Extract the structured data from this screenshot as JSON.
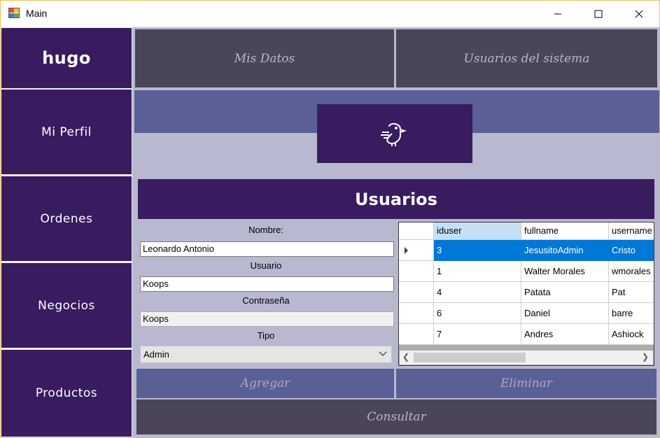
{
  "window": {
    "title": "Main"
  },
  "sidebar": {
    "brand": "hugo",
    "items": [
      {
        "label": "Mi Perfil"
      },
      {
        "label": "Ordenes"
      },
      {
        "label": "Negocios"
      },
      {
        "label": "Productos"
      }
    ]
  },
  "topnav": {
    "tabs": [
      {
        "label": "Mis Datos"
      },
      {
        "label": "Usuarios del sistema"
      }
    ]
  },
  "section": {
    "title": "Usuarios"
  },
  "form": {
    "nombre_label": "Nombre:",
    "nombre_value": "Leonardo Antonio",
    "usuario_label": "Usuario",
    "usuario_value": "Koops",
    "password_label": "Contraseña",
    "password_value": "Koops",
    "tipo_label": "Tipo",
    "tipo_value": "Admin"
  },
  "table": {
    "columns": [
      "iduser",
      "fullname",
      "username"
    ],
    "rows": [
      [
        "3",
        "JesusitoAdmin",
        "Cristo"
      ],
      [
        "1",
        "Walter Morales",
        "wmorales"
      ],
      [
        "4",
        "Patata",
        "Pat"
      ],
      [
        "6",
        "Daniel",
        "barre"
      ],
      [
        "7",
        "Andres",
        "Ashiock"
      ]
    ],
    "selected_row": 0
  },
  "actions": {
    "add_label": "Agregar",
    "delete_label": "Eliminar",
    "query_label": "Consultar"
  },
  "colors": {
    "sidebar": "#381c5f",
    "topbar": "#4a4657",
    "band": "#5a5f96",
    "background": "#b8b8d1",
    "selection": "#0078d7"
  }
}
